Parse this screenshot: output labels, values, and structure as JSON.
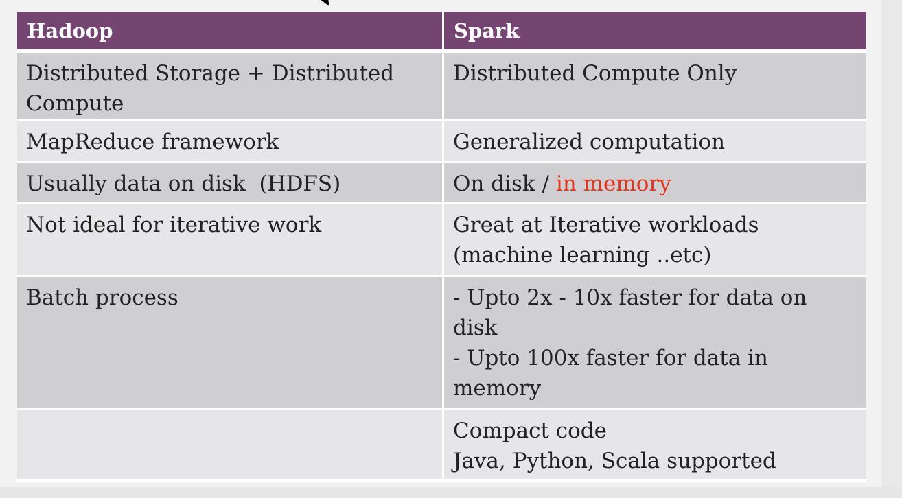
{
  "table": {
    "headers": [
      "Hadoop",
      "Spark"
    ],
    "rows": [
      {
        "hadoop": [
          "Distributed Storage + Distributed",
          "Compute"
        ],
        "spark": [
          "Distributed Compute Only"
        ]
      },
      {
        "hadoop": [
          "MapReduce framework"
        ],
        "spark": [
          "Generalized computation"
        ]
      },
      {
        "hadoop": [
          "Usually data on disk  (HDFS)"
        ],
        "spark_prefix": "On disk / ",
        "spark_highlight": "in memory"
      },
      {
        "hadoop": [
          "Not ideal for iterative work"
        ],
        "spark": [
          "Great at Iterative workloads",
          "(machine learning ..etc)"
        ]
      },
      {
        "hadoop": [
          "Batch process"
        ],
        "spark": [
          "- Upto 2x - 10x faster for data on",
          "disk",
          "- Upto 100x faster for data in",
          "memory"
        ]
      },
      {
        "hadoop": [
          ""
        ],
        "spark": [
          "Compact code",
          "Java, Python, Scala supported"
        ]
      }
    ]
  },
  "colors": {
    "header_bg": "#744570",
    "row_dark": "#cfcfd1",
    "row_light": "#e6e6e8",
    "highlight": "#e4321b"
  }
}
